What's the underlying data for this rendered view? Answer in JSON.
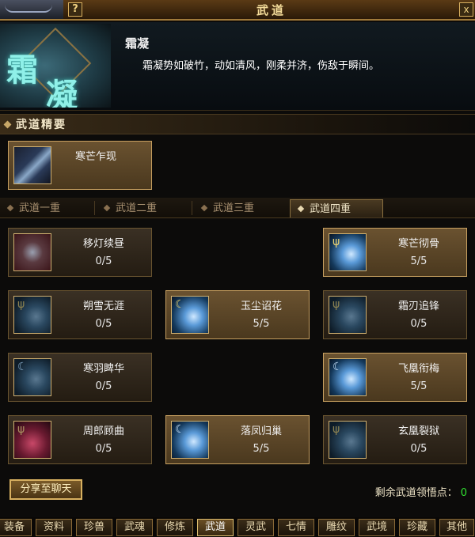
{
  "window": {
    "title": "武道",
    "help_label": "?",
    "close_label": "x"
  },
  "header": {
    "logo_chars": [
      "霜",
      "凝"
    ],
    "skill_name": "霜凝",
    "description": "霜凝势如破竹，动如清风，刚柔并济，伤敌于瞬间。"
  },
  "essence": {
    "heading": "武道精要",
    "card": {
      "name": "寒芒乍现",
      "icon": "blade-icon"
    }
  },
  "tier_tabs": [
    "武道一重",
    "武道二重",
    "武道三重",
    "武道四重"
  ],
  "selected_tier": 3,
  "skills": [
    {
      "name": "移灯续昼",
      "level": "0/5",
      "icon": "hand-icon",
      "active": false
    },
    {
      "name": "寒芒彻骨",
      "level": "5/5",
      "icon": "ice-icon",
      "active": true
    },
    {
      "name": "朔雪无涯",
      "level": "0/5",
      "icon": "ice-icon",
      "active": false
    },
    {
      "name": "玉尘诏花",
      "level": "5/5",
      "icon": "ice-icon",
      "active": true
    },
    {
      "name": "霜刃追锋",
      "level": "0/5",
      "icon": "ice-icon",
      "active": false
    },
    {
      "name": "寒羽睥华",
      "level": "0/5",
      "icon": "ice-icon",
      "active": false
    },
    {
      "name": "飞凰衔梅",
      "level": "5/5",
      "icon": "ice-icon",
      "active": true
    },
    {
      "name": "周郎顾曲",
      "level": "0/5",
      "icon": "flower-icon",
      "active": false
    },
    {
      "name": "落凤归巢",
      "level": "5/5",
      "icon": "ice-icon",
      "active": true
    },
    {
      "name": "玄凰裂狱",
      "level": "0/5",
      "icon": "ice-icon",
      "active": false
    }
  ],
  "footer": {
    "share_label": "分享至聊天",
    "points_label": "剩余武道领悟点：",
    "points_value": "0"
  },
  "bottom_tabs": [
    "装备",
    "资料",
    "珍兽",
    "武魂",
    "修炼",
    "武道",
    "灵武",
    "七情",
    "雕纹",
    "武境",
    "珍藏",
    "其他"
  ],
  "selected_bottom_tab": 5
}
